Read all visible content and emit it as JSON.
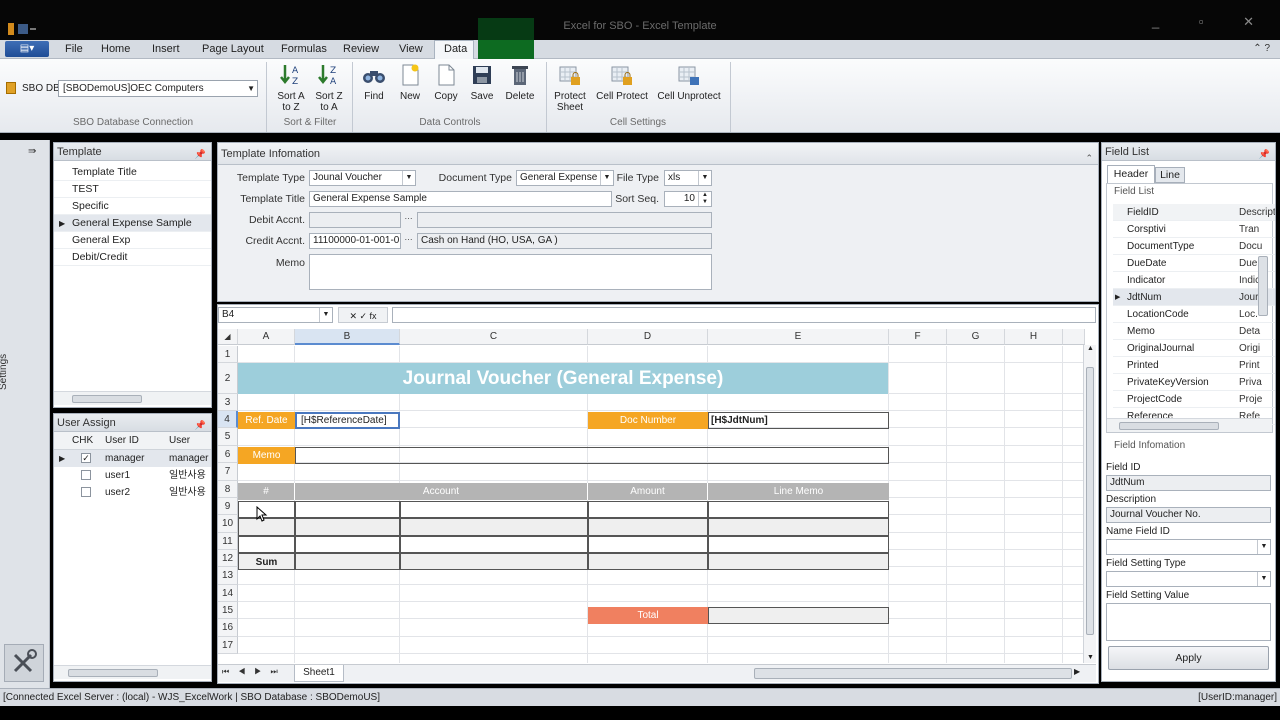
{
  "window": {
    "title": "Excel for SBO - Excel Template",
    "controls": "_ ▫ ✕"
  },
  "menu": {
    "file": "▤▾",
    "tabs": [
      "File",
      "Home",
      "Insert",
      "Page Layout",
      "Formulas",
      "Review",
      "View",
      "Data"
    ],
    "help": "⌃ ?"
  },
  "ribbon": {
    "sbo_db_label": "SBO DB",
    "sbo_db_value": "[SBODemoUS]OEC Computers",
    "sbo_group": "SBO Database Connection",
    "sort_az": [
      "Sort A",
      "to Z"
    ],
    "sort_za": [
      "Sort Z",
      "to A"
    ],
    "sort_group": "Sort & Filter",
    "find": "Find",
    "new": "New",
    "copy": "Copy",
    "save": "Save",
    "delete": "Delete",
    "data_group": "Data Controls",
    "protect": [
      "Protect",
      "Sheet"
    ],
    "cell_protect": "Cell Protect",
    "cell_unprotect": "Cell Unprotect",
    "cell_group": "Cell Settings"
  },
  "sidebar": {
    "label": "Settings",
    "expand": "⇛"
  },
  "template_panel": {
    "title": "Template",
    "items": [
      "Template Title",
      "TEST",
      "Specific",
      "General Expense Sample",
      "General Exp",
      "Debit/Credit"
    ]
  },
  "user_panel": {
    "title": "User Assign",
    "cols": [
      "CHK",
      "User ID",
      "User Nam"
    ],
    "rows": [
      {
        "id": "manager",
        "name": "manager",
        "checked": true
      },
      {
        "id": "user1",
        "name": "일반사용",
        "checked": false
      },
      {
        "id": "user2",
        "name": "일반사용",
        "checked": false
      }
    ]
  },
  "template_info": {
    "title": "Template Infomation",
    "template_type_label": "Template Type",
    "template_type": "Jounal Voucher",
    "doc_type_label": "Document Type",
    "doc_type": "General Expense",
    "file_type_label": "File Type",
    "file_type": "xls",
    "template_title_label": "Template Title",
    "template_title": "General Expense Sample",
    "sort_seq_label": "Sort Seq.",
    "sort_seq": "10",
    "debit_label": "Debit Accnt.",
    "debit_code": "",
    "debit_name": "",
    "credit_label": "Credit Accnt.",
    "credit_code": "11100000-01-001-0",
    "credit_name": "Cash on Hand (HO, USA, GA )",
    "memo_label": "Memo",
    "ellipsis": "···"
  },
  "formula_bar": {
    "name_box": "B4",
    "icons": "✕ ✓ fx",
    "formula": ""
  },
  "sheet": {
    "columns": [
      "A",
      "B",
      "C",
      "D",
      "E",
      "F",
      "G",
      "H"
    ],
    "rows": [
      "1",
      "2",
      "3",
      "4",
      "5",
      "6",
      "7",
      "8",
      "9",
      "10",
      "11",
      "12",
      "13",
      "14",
      "15",
      "16",
      "17"
    ],
    "title": "Journal Voucher (General Expense)",
    "ref_date_label": "Ref. Date",
    "ref_date_value": "[H$ReferenceDate]",
    "doc_number_label": "Doc Number",
    "doc_number_value": "[H$JdtNum]",
    "memo_label": "Memo",
    "table_headers": [
      "#",
      "Account",
      "Amount",
      "Line Memo"
    ],
    "sum_label": "Sum",
    "total_label": "Total",
    "tab": "Sheet1",
    "colors": {
      "title_bg": "#9dcedb",
      "orange": "#f5a623",
      "total": "#f08060",
      "gray": "#b4b4b4",
      "selected": "#d9e4f2"
    }
  },
  "field_list": {
    "title": "Field List",
    "tabs": [
      "Header",
      "Line"
    ],
    "sub": "Field List",
    "cols": [
      "FieldID",
      "Descript"
    ],
    "rows": [
      [
        "Corsptivi",
        "Tran"
      ],
      [
        "DocumentType",
        "Docu"
      ],
      [
        "DueDate",
        "Due"
      ],
      [
        "Indicator",
        "Indic"
      ],
      [
        "JdtNum",
        "Journ"
      ],
      [
        "LocationCode",
        "Loc."
      ],
      [
        "Memo",
        "Deta"
      ],
      [
        "OriginalJournal",
        "Origi"
      ],
      [
        "Printed",
        "Print"
      ],
      [
        "PrivateKeyVersion",
        "Priva"
      ],
      [
        "ProjectCode",
        "Proje"
      ],
      [
        "Reference",
        "Refe"
      ]
    ],
    "info_title": "Field Infomation",
    "field_id_label": "Field ID",
    "field_id": "JdtNum",
    "desc_label": "Description",
    "desc": "Journal Voucher No.",
    "name_field_label": "Name Field ID",
    "setting_type_label": "Field Setting Type",
    "setting_value_label": "Field Setting Value",
    "apply": "Apply"
  },
  "status": {
    "left": "[Connected Excel Server : (local) - WJS_ExcelWork | SBO Database : SBODemoUS]",
    "right": "[UserID:manager]"
  }
}
